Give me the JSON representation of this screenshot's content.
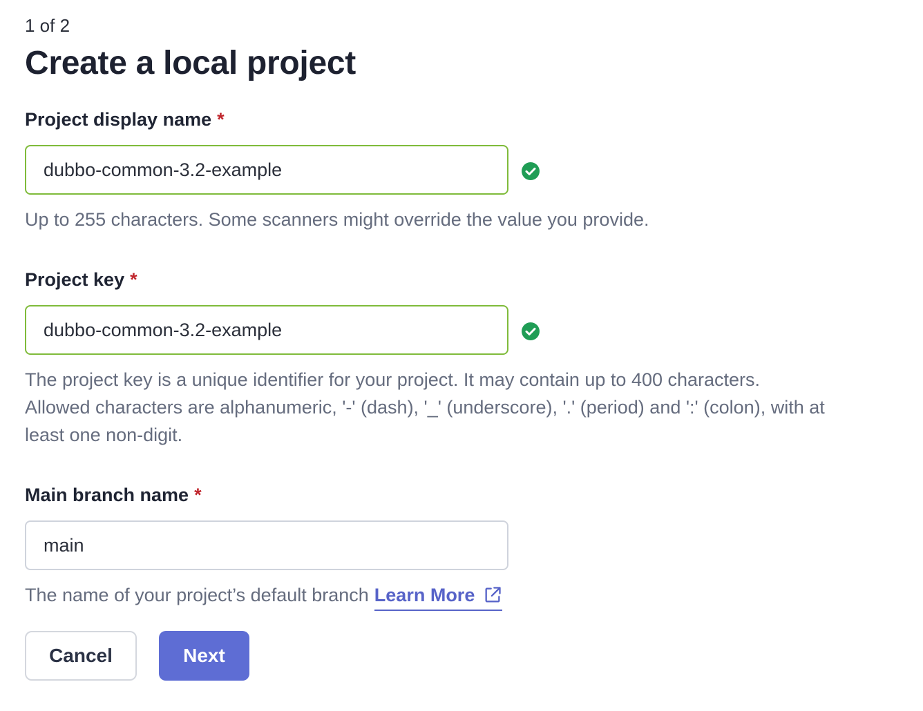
{
  "header": {
    "step": "1 of 2",
    "title": "Create a local project"
  },
  "form": {
    "display_name": {
      "label": "Project display name",
      "required_mark": "*",
      "value": "dubbo-common-3.2-example",
      "status": "valid",
      "status_icon": "check-circle-icon",
      "help": "Up to 255 characters. Some scanners might override the value you provide."
    },
    "project_key": {
      "label": "Project key",
      "required_mark": "*",
      "value": "dubbo-common-3.2-example",
      "status": "valid",
      "status_icon": "check-circle-icon",
      "help_line1": "The project key is a unique identifier for your project. It may contain up to 400 characters.",
      "help_line2": "Allowed characters are alphanumeric, '-' (dash), '_' (underscore), '.' (period) and ':' (colon), with at",
      "help_line3": "least one non-digit."
    },
    "main_branch": {
      "label": "Main branch name",
      "required_mark": "*",
      "value": "main",
      "help": "The name of your project’s default branch",
      "link_label": "Learn More",
      "link_icon": "external-link-icon"
    }
  },
  "actions": {
    "cancel_label": "Cancel",
    "next_label": "Next"
  },
  "colors": {
    "required": "#c0262d",
    "valid_border": "#7fbb3a",
    "valid_icon": "#1f9d55",
    "link": "#5763c8",
    "primary": "#5e6dd4",
    "help_text": "#656c7e"
  }
}
